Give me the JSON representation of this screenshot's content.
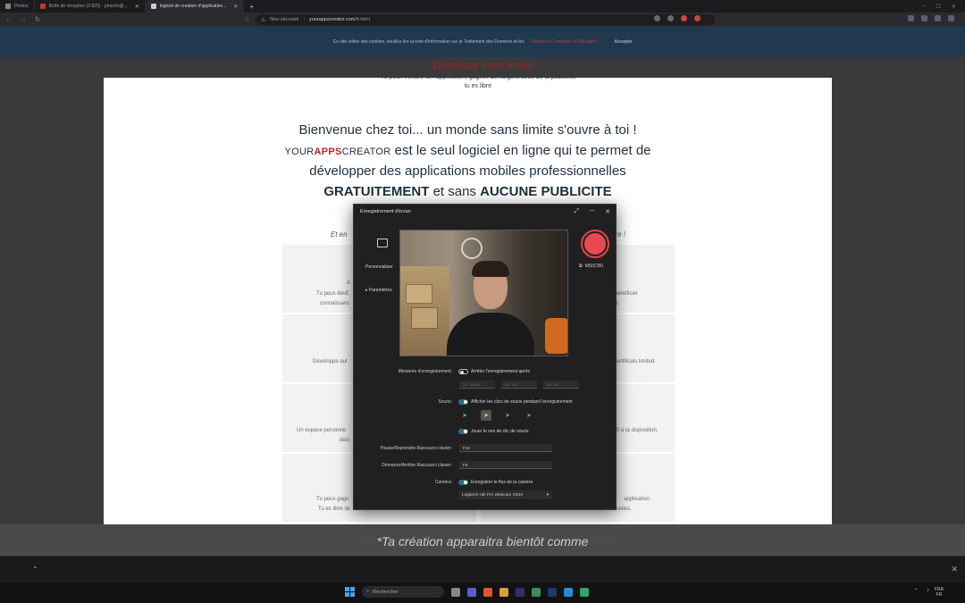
{
  "browser": {
    "tabs": [
      {
        "label": "Photos"
      },
      {
        "label": "Boîte de réception (3 825) - pmartin@..."
      },
      {
        "label": "logiciel de creation d'application..."
      }
    ],
    "new_tab": "+",
    "url_warning": "Non sécurisé",
    "url_host": "yourappscreator.com",
    "url_path": "/fr.html"
  },
  "cookie": {
    "text": "Ce site utilise des cookies, veuillez lire la note d'information sur le Traitement des Données et les",
    "link": "Règles et Conditions d'Utilisation",
    "accept": "Accepter"
  },
  "page": {
    "red_heading": "Distribuer sans limite",
    "subtext": "Tu peux vendre ton application, gagner de l'argent avec de la publicité, tu es libre",
    "hero_line1": "Bienvenue chez toi... un monde sans limite s'ouvre à toi !",
    "brand_your": "YOUR",
    "brand_apps": "APPS",
    "brand_creator": "CREATOR",
    "hero_line2": " est le seul logiciel en ligne qui te permet de",
    "hero_line3": "développer des applications mobiles professionnelles",
    "hero_gratuit": "GRATUITEMENT",
    "hero_and": " et sans ",
    "hero_aucune": "AUCUNE PUBLICITE",
    "tagline_left": "Et en",
    "tagline_right": "re !",
    "cards": [
      {
        "t1": "A",
        "t2": "Tu peux dévE",
        "t3": "connaissanc",
        "r1": "bénéficier",
        "r2": "t."
      },
      {
        "t1": "Développe aut",
        "t2": "",
        "t3": "",
        "r1": "certificats limited.",
        "r2": ""
      },
      {
        "t1": "Un espace personne",
        "t2": "desi",
        "t3": "",
        "r1": "'S à ta disposition.",
        "r2": ""
      },
      {
        "t1": "Tu peux gagn",
        "t2": "Tu es libre de",
        "t3": "",
        "r1": "application.",
        "r2": "nnelles."
      }
    ],
    "bottom_text": "*Ta création apparaitra bientôt comme"
  },
  "recorder": {
    "title": "Enregistrement d'écran",
    "side_personalize": "Personnaliser",
    "side_params": "Paramètres",
    "mic": "MSI(CBI)",
    "timer_label": "Minuterie d'enregistrement:",
    "timer_opt": "Arrêter l'enregistrement après",
    "timer_h": "23",
    "timer_h_unit": "heure",
    "timer_m": "59",
    "timer_m_unit": "min",
    "timer_s": "59",
    "timer_s_unit": "sec",
    "mouse_label": "Souris:",
    "mouse_opt": "Afficher les clics de souris pendant l'enregistrement",
    "sound_opt": "Jouer le son de clic de souris",
    "pause_label": "Pause/Reprendre Raccourci clavier:",
    "pause_key": "F10",
    "start_label": "Démarrer/Arrêter Raccourci clavier:",
    "start_key": "F9",
    "camera_label": "Caméra:",
    "camera_opt": "Enregistrer le flux de la caméra",
    "camera_device": "Logitech HD Pro Webcam C910"
  },
  "taskbar": {
    "search": "Rechercher",
    "lang1": "FRA",
    "lang2": "FR"
  },
  "colors": {
    "accent_red": "#b0262a",
    "record": "#e8484f",
    "toggle_on": "#2f6b8f"
  }
}
